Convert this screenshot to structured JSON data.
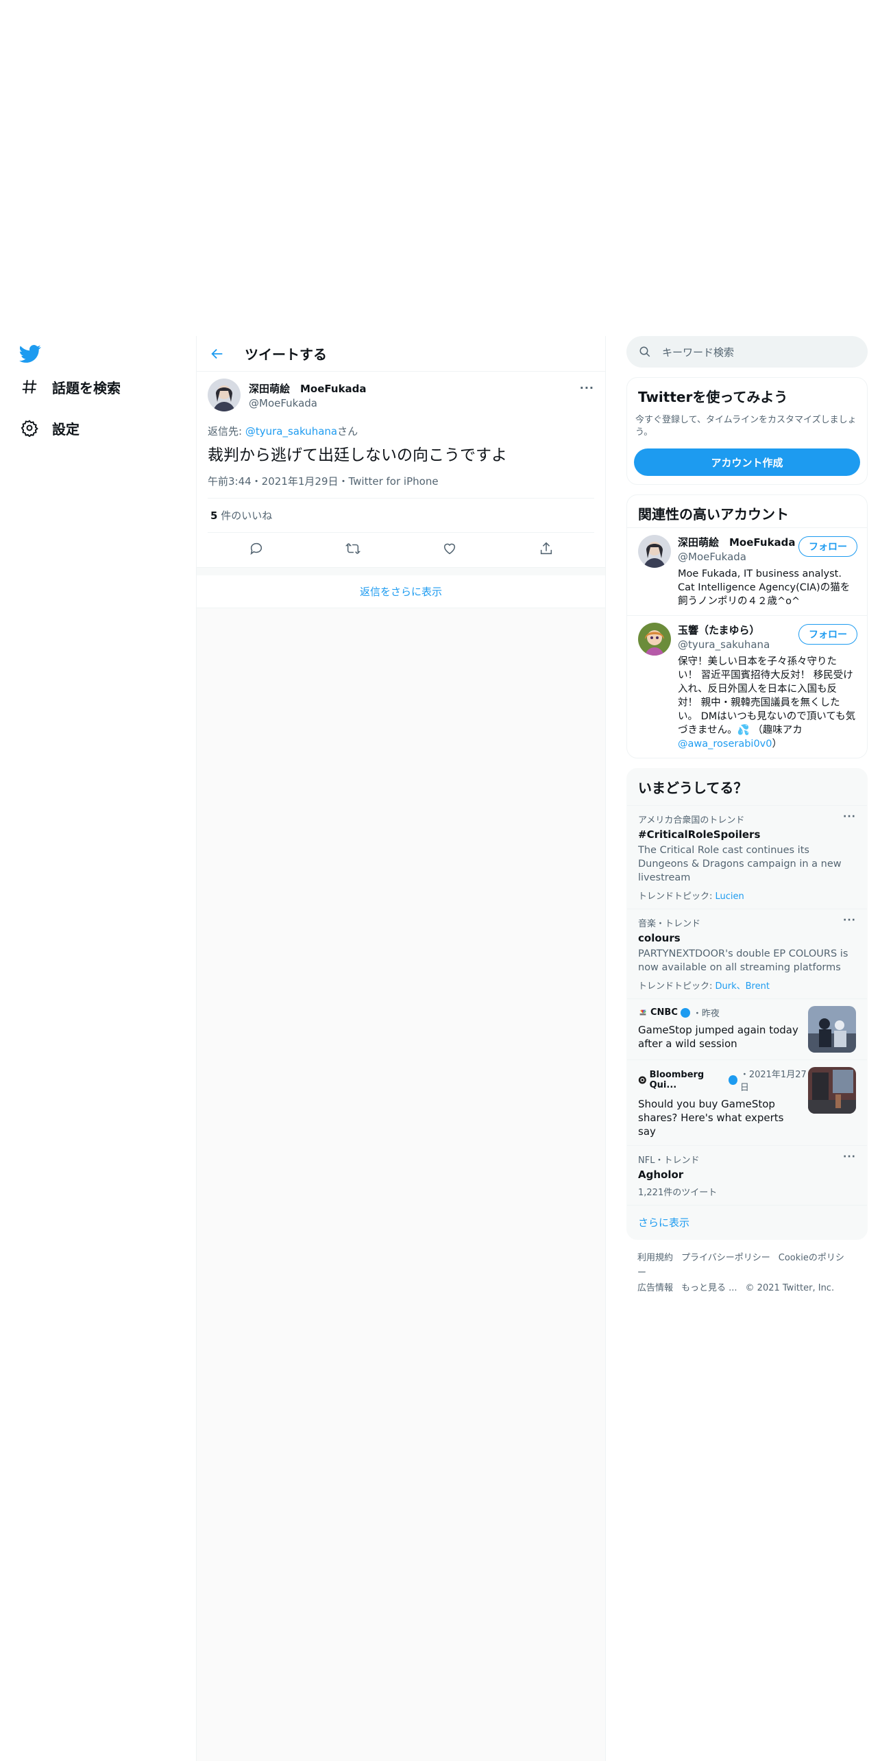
{
  "nav": {
    "explore_label": "話題を検索",
    "settings_label": "設定"
  },
  "header": {
    "title": "ツイートする"
  },
  "tweet": {
    "display_name": "深田萌絵　MoeFukada",
    "handle": "@MoeFukada",
    "reply_prefix": "返信先: ",
    "reply_to": "@tyura_sakuhana",
    "reply_suffix": "さん",
    "text": "裁判から逃げて出廷しないの向こうですよ",
    "meta": "午前3:44・2021年1月29日・Twitter for iPhone",
    "likes_count": "5",
    "likes_label": " 件のいいね",
    "more_replies": "返信をさらに表示"
  },
  "search": {
    "placeholder": "キーワード検索"
  },
  "signup": {
    "title": "Twitterを使ってみよう",
    "subtitle": "今すぐ登録して、タイムラインをカスタマイズしましょう。",
    "button": "アカウント作成"
  },
  "related": {
    "title": "関連性の高いアカウント",
    "accounts": [
      {
        "name": "深田萌絵　MoeFukada",
        "handle": "@MoeFukada",
        "bio": "Moe Fukada, IT business analyst. Cat Intelligence Agency(CIA)の猫を飼うノンポリの４２歳^o^",
        "follow": "フォロー"
      },
      {
        "name": "玉響（たまゆら）",
        "handle": "@tyura_sakuhana",
        "bio": "保守！美しい日本を子々孫々守りたい！ 習近平国賓招待大反対！ 移民受け入れ、反日外国人を日本に入国も反対！ 親中・親韓売国議員を無くしたい。 DMはいつも見ないので頂いても気づきません。💦 （趣味アカ",
        "bio_link": "@awa_roserabi0v0",
        "bio_end": "）",
        "follow": "フォロー"
      }
    ]
  },
  "trends": {
    "title": "いまどうしてる？",
    "items": [
      {
        "context": "アメリカ合衆国のトレンド",
        "title": "#CriticalRoleSpoilers",
        "desc": "The Critical Role cast continues its Dungeons & Dragons campaign in a new livestream",
        "topic_label": "トレンドトピック: ",
        "topic": "Lucien"
      },
      {
        "context": "音楽・トレンド",
        "title": "colours",
        "desc": "PARTYNEXTDOOR's double EP COLOURS is now available on all streaming platforms",
        "topic_label": "トレンドトピック: ",
        "topic": "Durk、Brent"
      }
    ],
    "news": [
      {
        "source": "CNBC",
        "time": "・昨夜",
        "title": "GameStop jumped again today after a wild session"
      },
      {
        "source": "Bloomberg Qui...",
        "time": "・2021年1月27日",
        "title": "Should you buy GameStop shares? Here's what experts say"
      }
    ],
    "last": {
      "context": "NFL・トレンド",
      "title": "Agholor",
      "count": "1,221件のツイート"
    },
    "show_more": "さらに表示"
  },
  "footer": {
    "terms": "利用規約",
    "privacy": "プライバシーポリシー",
    "cookie": "Cookieのポリシー",
    "ads": "広告情報",
    "more": "もっと見る ...",
    "copyright": "© 2021 Twitter, Inc."
  },
  "colors": {
    "accent": "#1d9bf0",
    "text": "#0f1419",
    "secondary": "#536471"
  }
}
